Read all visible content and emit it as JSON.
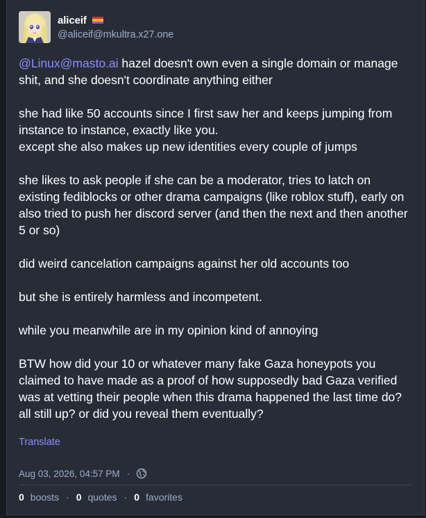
{
  "account": {
    "display_name": "aliceif",
    "handle": "@aliceif@mkultra.x27.one",
    "avatar_icon": "anime-avatar-icon",
    "flag_icon": "pride-flag-icon"
  },
  "post": {
    "mention": "@Linux@masto.ai",
    "p1_rest": " hazel doesn't own even a single domain or manage shit, and she doesn't coordinate anything either",
    "p2_line1": "she had like 50 accounts since I first saw her and keeps jumping from instance to instance, exactly like you.",
    "p2_line2": "except she also makes up new identities every couple of jumps",
    "p3": "she likes to ask people if she can be a moderator, tries to latch on existing fediblocks or other drama campaigns (like roblox stuff), early on also tried to push her discord server (and then the next and then another 5 or so)",
    "p4": "did weird cancelation campaigns against her old accounts too",
    "p5": "but she is entirely harmless and incompetent.",
    "p6": "while you meanwhile are in my opinion kind of annoying",
    "p7": "BTW how did your 10 or whatever many fake Gaza honeypots you claimed to have made as a proof of how supposedly bad Gaza verified was at vetting their people when this drama happened the last time do? all still up? or did you reveal them eventually?"
  },
  "actions": {
    "translate_label": "Translate"
  },
  "meta": {
    "timestamp": "Aug 03, 2026, 04:57 PM",
    "separator": "·",
    "visibility_icon": "globe-icon"
  },
  "counts": {
    "boosts_count": "0",
    "boosts_label": "boosts",
    "quotes_count": "0",
    "quotes_label": "quotes",
    "favorites_count": "0",
    "favorites_label": "favorites",
    "separator": "·"
  },
  "colors": {
    "background": "#191b22",
    "card": "#282c37",
    "accent": "#8c8dff",
    "muted": "#9baec8",
    "text": "#ffffff"
  }
}
